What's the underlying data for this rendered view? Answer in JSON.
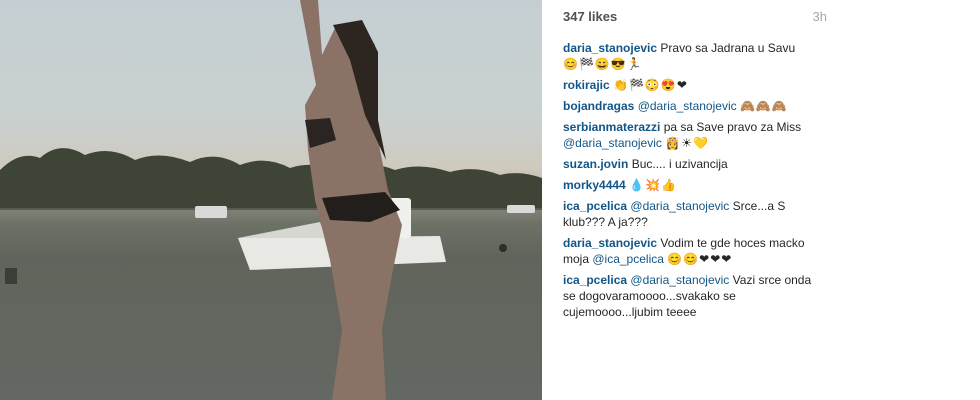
{
  "post": {
    "likes": "347 likes",
    "time": "3h"
  },
  "comments": [
    {
      "user": "daria_stanojevic",
      "mention": "",
      "text": "Pravo sa Jadrana u Savu",
      "emoji": "😊🏁😄😎🏃"
    },
    {
      "user": "rokirajic",
      "mention": "",
      "text": "",
      "emoji": "👏🏁😳😍❤"
    },
    {
      "user": "bojandragas",
      "mention": "@daria_stanojevic",
      "text": "",
      "emoji": "🙈🙈🙈"
    },
    {
      "user": "serbianmaterazzi",
      "mention": "",
      "text": "pa sa Save pravo za Miss",
      "mention2": "@daria_stanojevic",
      "emoji": "👸☀💛"
    },
    {
      "user": "suzan.jovin",
      "mention": "",
      "text": "Buc.... i uzivancija",
      "emoji": ""
    },
    {
      "user": "morky4444",
      "mention": "",
      "text": "",
      "emoji": "💧💥👍"
    },
    {
      "user": "ica_pcelica",
      "mention": "@daria_stanojevic",
      "text": "Srce...a S klub??? A ja???",
      "emoji": ""
    },
    {
      "user": "daria_stanojevic",
      "mention": "",
      "text": "Vodim te gde hoces macko moja",
      "mention2": "@ica_pcelica",
      "emoji": "😊😊❤❤❤"
    },
    {
      "user": "ica_pcelica",
      "mention": "@daria_stanojevic",
      "text": "Vazi srce onda se dogovaramoooo...svakako se cujemoooo...ljubim teeee",
      "emoji": ""
    }
  ],
  "icons": {
    "photo": "beach-photo"
  },
  "colors": {
    "username": "#125688",
    "likes": "#515151",
    "time": "#a5a7aa"
  }
}
